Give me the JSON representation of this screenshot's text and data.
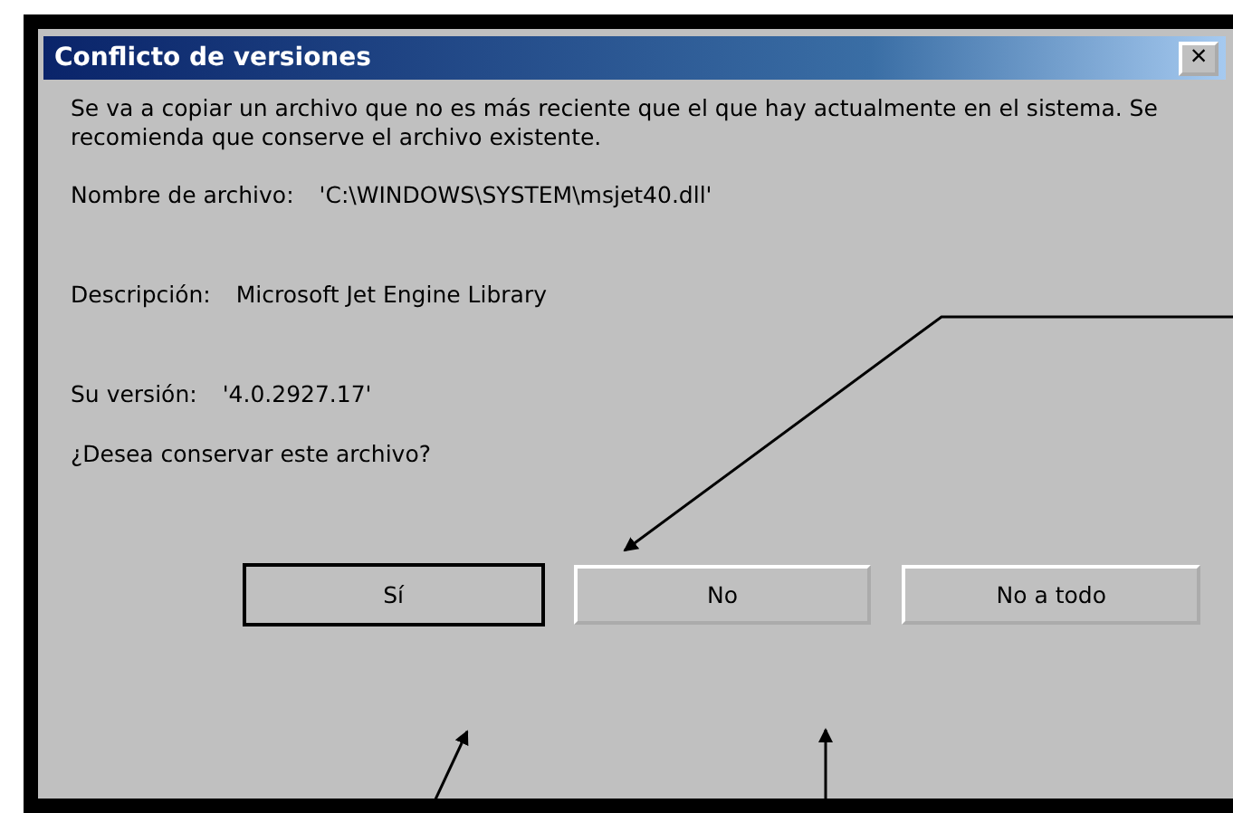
{
  "window": {
    "title": "Conflicto de versiones",
    "close": "×"
  },
  "message": "Se va a copiar un archivo que no es más reciente que el que hay actualmente en el sistema. Se recomienda que conserve el archivo existente.",
  "fields": [
    {
      "label": "Nombre de archivo:",
      "value": "'C:\\WINDOWS\\SYSTEM\\msjet40.dll'"
    },
    {
      "label": "Descripción:",
      "value": "Microsoft Jet Engine Library"
    },
    {
      "label": "Su versión:",
      "value": "'4.0.2927.17'"
    }
  ],
  "question": "¿Desea conservar este archivo?",
  "buttons": [
    {
      "label": "Sí",
      "default": true
    },
    {
      "label": "No",
      "default": false
    },
    {
      "label": "No a todo",
      "default": false
    }
  ]
}
